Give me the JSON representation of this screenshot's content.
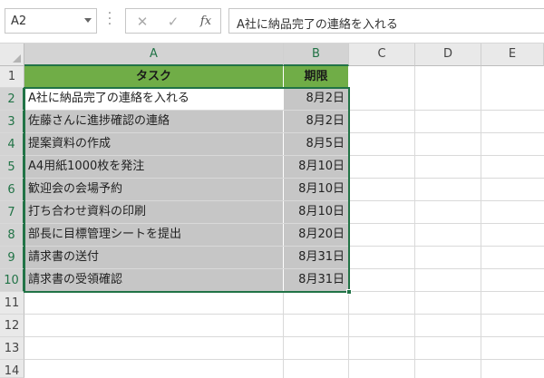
{
  "namebox": {
    "value": "A2"
  },
  "formula_bar": {
    "icons": [
      "cancel-icon",
      "enter-icon",
      "function-icon"
    ],
    "cancel_glyph": "✕",
    "enter_glyph": "✓",
    "fx_glyph": "fx",
    "value": "A社に納品完了の連絡を入れる"
  },
  "columns": [
    "A",
    "B",
    "C",
    "D",
    "E"
  ],
  "rows": [
    "1",
    "2",
    "3",
    "4",
    "5",
    "6",
    "7",
    "8",
    "9",
    "10",
    "11",
    "12",
    "13",
    "14"
  ],
  "table": {
    "headers": [
      "タスク",
      "期限"
    ],
    "rows": [
      [
        "A社に納品完了の連絡を入れる",
        "8月2日"
      ],
      [
        "佐藤さんに進捗確認の連絡",
        "8月2日"
      ],
      [
        "提案資料の作成",
        "8月5日"
      ],
      [
        "A4用紙1000枚を発注",
        "8月10日"
      ],
      [
        "歓迎会の会場予約",
        "8月10日"
      ],
      [
        "打ち合わせ資料の印刷",
        "8月10日"
      ],
      [
        "部長に目標管理シートを提出",
        "8月20日"
      ],
      [
        "請求書の送付",
        "8月31日"
      ],
      [
        "請求書の受領確認",
        "8月31日"
      ]
    ]
  },
  "colors": {
    "header_fill": "#70ad47",
    "data_fill": "#c6c6c6",
    "selection": "#217346"
  }
}
